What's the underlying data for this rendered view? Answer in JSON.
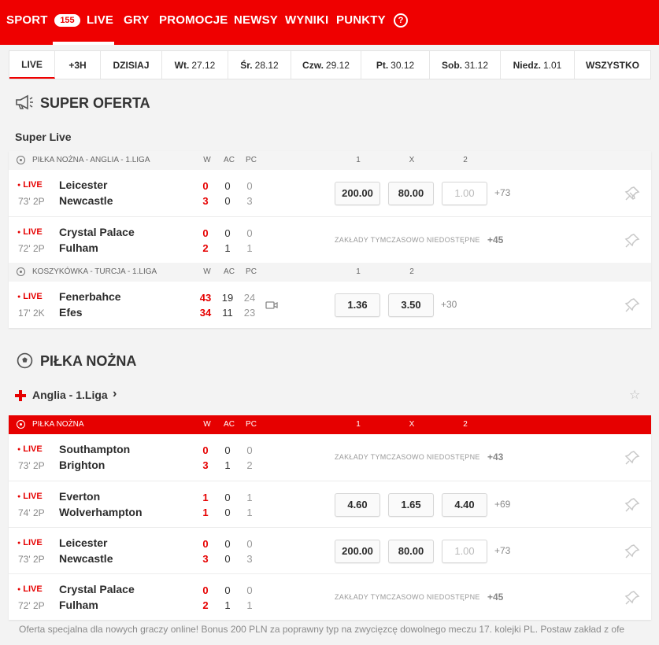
{
  "nav": {
    "items": [
      "SPORT",
      "LIVE",
      "GRY",
      "PROMOCJE",
      "NEWSY",
      "WYNIKI",
      "PUNKTY"
    ],
    "live_count": "155",
    "help": "?"
  },
  "tabs": [
    {
      "label": "LIVE",
      "day": "",
      "date": ""
    },
    {
      "label": "+3H",
      "day": "",
      "date": ""
    },
    {
      "label": "DZISIAJ",
      "day": "",
      "date": ""
    },
    {
      "label": "",
      "day": "Wt.",
      "date": "27.12"
    },
    {
      "label": "",
      "day": "Śr.",
      "date": "28.12"
    },
    {
      "label": "",
      "day": "Czw.",
      "date": "29.12"
    },
    {
      "label": "",
      "day": "Pt.",
      "date": "30.12"
    },
    {
      "label": "",
      "day": "Sob.",
      "date": "31.12"
    },
    {
      "label": "",
      "day": "Niedz.",
      "date": "1.01"
    },
    {
      "label": "WSZYSTKO",
      "day": "",
      "date": ""
    }
  ],
  "super_oferta": {
    "title": "SUPER OFERTA",
    "subtitle": "Super Live",
    "groups": [
      {
        "sport": "PIŁKA NOŻNA - ANGLIA - 1.LIGA",
        "cols": [
          "W",
          "AC",
          "PC"
        ],
        "odds_headers": [
          "1",
          "X",
          "2"
        ],
        "matches": [
          {
            "status": "LIVE",
            "time": "73' 2P",
            "home": "Leicester",
            "away": "Newcastle",
            "w": [
              "0",
              "3"
            ],
            "ac": [
              "0",
              "0"
            ],
            "pc": [
              "0",
              "3"
            ],
            "odds": [
              "200.00",
              "80.00",
              "1.00"
            ],
            "odds_disabled": [
              false,
              false,
              true
            ],
            "more": "+73",
            "unavailable": ""
          },
          {
            "status": "LIVE",
            "time": "72' 2P",
            "home": "Crystal Palace",
            "away": "Fulham",
            "w": [
              "0",
              "2"
            ],
            "ac": [
              "0",
              "1"
            ],
            "pc": [
              "0",
              "1"
            ],
            "odds": [],
            "odds_disabled": [],
            "more": "+45",
            "unavailable": "ZAKŁADY TYMCZASOWO NIEDOSTĘPNE"
          }
        ]
      },
      {
        "sport": "KOSZYKÓWKA - TURCJA - 1.LIGA",
        "cols": [
          "W",
          "AC",
          "PC"
        ],
        "odds_headers": [
          "1",
          "2"
        ],
        "matches": [
          {
            "status": "LIVE",
            "time": "17' 2K",
            "home": "Fenerbahce",
            "away": "Efes",
            "w": [
              "43",
              "34"
            ],
            "ac": [
              "19",
              "11"
            ],
            "pc": [
              "24",
              "23"
            ],
            "odds": [
              "1.36",
              "3.50"
            ],
            "odds_disabled": [
              false,
              false
            ],
            "more": "+30",
            "unavailable": ""
          }
        ]
      }
    ]
  },
  "pilka": {
    "title": "PIŁKA NOŻNA",
    "league": "Anglia - 1.Liga",
    "group": {
      "sport": "PIŁKA NOŻNA",
      "cols": [
        "W",
        "AC",
        "PC"
      ],
      "odds_headers": [
        "1",
        "X",
        "2"
      ],
      "matches": [
        {
          "status": "LIVE",
          "time": "73' 2P",
          "home": "Southampton",
          "away": "Brighton",
          "w": [
            "0",
            "3"
          ],
          "ac": [
            "0",
            "1"
          ],
          "pc": [
            "0",
            "2"
          ],
          "odds": [],
          "odds_disabled": [],
          "more": "+43",
          "unavailable": "ZAKŁADY TYMCZASOWO NIEDOSTĘPNE"
        },
        {
          "status": "LIVE",
          "time": "74' 2P",
          "home": "Everton",
          "away": "Wolverhampton",
          "w": [
            "1",
            "1"
          ],
          "ac": [
            "0",
            "0"
          ],
          "pc": [
            "1",
            "1"
          ],
          "odds": [
            "4.60",
            "1.65",
            "4.40"
          ],
          "odds_disabled": [
            false,
            false,
            false
          ],
          "more": "+69",
          "unavailable": ""
        },
        {
          "status": "LIVE",
          "time": "73' 2P",
          "home": "Leicester",
          "away": "Newcastle",
          "w": [
            "0",
            "3"
          ],
          "ac": [
            "0",
            "0"
          ],
          "pc": [
            "0",
            "3"
          ],
          "odds": [
            "200.00",
            "80.00",
            "1.00"
          ],
          "odds_disabled": [
            false,
            false,
            true
          ],
          "more": "+73",
          "unavailable": ""
        },
        {
          "status": "LIVE",
          "time": "72' 2P",
          "home": "Crystal Palace",
          "away": "Fulham",
          "w": [
            "0",
            "2"
          ],
          "ac": [
            "0",
            "1"
          ],
          "pc": [
            "0",
            "1"
          ],
          "odds": [],
          "odds_disabled": [],
          "more": "+45",
          "unavailable": "ZAKŁADY TYMCZASOWO NIEDOSTĘPNE"
        }
      ]
    }
  },
  "footer": "Oferta specjalna dla nowych graczy online! Bonus 200 PLN za poprawny typ na zwycięzcę dowolnego meczu 17. kolejki PL. Postaw zakład z ofe",
  "colors": {
    "brand": "#ef0000",
    "live": "#e60000"
  }
}
